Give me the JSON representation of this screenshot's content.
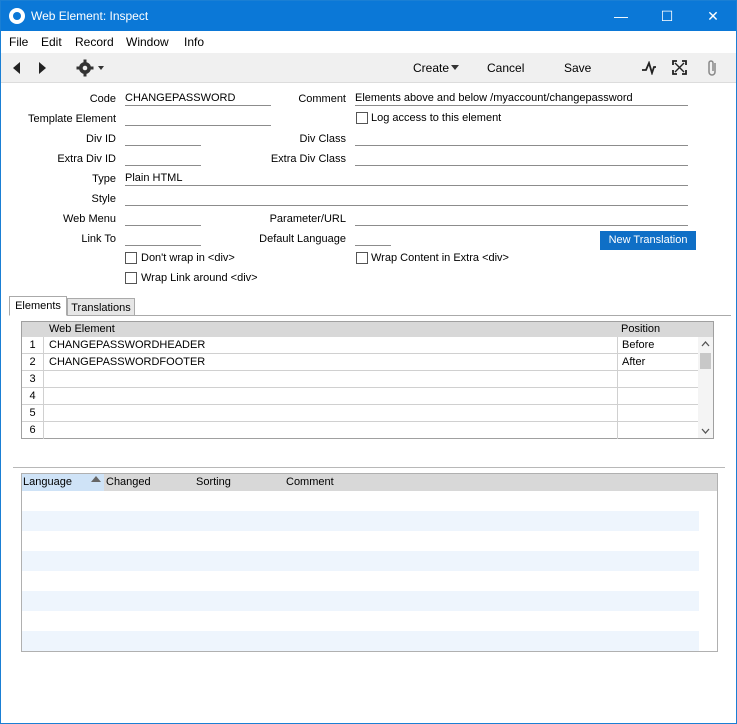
{
  "window": {
    "title": "Web Element: Inspect"
  },
  "menu": [
    "File",
    "Edit",
    "Record",
    "Window",
    "Info"
  ],
  "toolbar": {
    "create_label": "Create",
    "cancel_label": "Cancel",
    "save_label": "Save"
  },
  "form": {
    "code_label": "Code",
    "code_value": "CHANGEPASSWORD",
    "comment_label": "Comment",
    "comment_value": "Elements above and below /myaccount/changepassword",
    "template_label": "Template Element",
    "template_value": "",
    "log_access_label": "Log access to this element",
    "divid_label": "Div ID",
    "divid_value": "",
    "divclass_label": "Div Class",
    "divclass_value": "",
    "extradivid_label": "Extra Div ID",
    "extradivid_value": "",
    "extradivclass_label": "Extra Div Class",
    "extradivclass_value": "",
    "type_label": "Type",
    "type_value": "Plain HTML",
    "style_label": "Style",
    "style_value": "",
    "webmenu_label": "Web Menu",
    "webmenu_value": "",
    "param_label": "Parameter/URL",
    "param_value": "",
    "linkto_label": "Link To",
    "linkto_value": "",
    "deflang_label": "Default Language",
    "deflang_value": "",
    "new_translation_label": "New Translation",
    "dont_wrap_label": "Don't wrap in <div>",
    "wrap_extra_label": "Wrap Content in Extra <div>",
    "wrap_link_label": "Wrap Link around <div>"
  },
  "tabs": {
    "elements": "Elements",
    "translations": "Translations"
  },
  "elements_grid": {
    "headers": {
      "element": "Web Element",
      "position": "Position"
    },
    "rows": [
      {
        "num": "1",
        "element": "CHANGEPASSWORDHEADER",
        "position": "Before"
      },
      {
        "num": "2",
        "element": "CHANGEPASSWORDFOOTER",
        "position": "After"
      },
      {
        "num": "3",
        "element": "",
        "position": ""
      },
      {
        "num": "4",
        "element": "",
        "position": ""
      },
      {
        "num": "5",
        "element": "",
        "position": ""
      },
      {
        "num": "6",
        "element": "",
        "position": ""
      }
    ]
  },
  "translations_list": {
    "headers": {
      "language": "Language",
      "changed": "Changed",
      "sorting": "Sorting",
      "comment": "Comment"
    }
  },
  "colors": {
    "titlebar": "#0b78d7",
    "primary_button": "#0f6fc6"
  }
}
